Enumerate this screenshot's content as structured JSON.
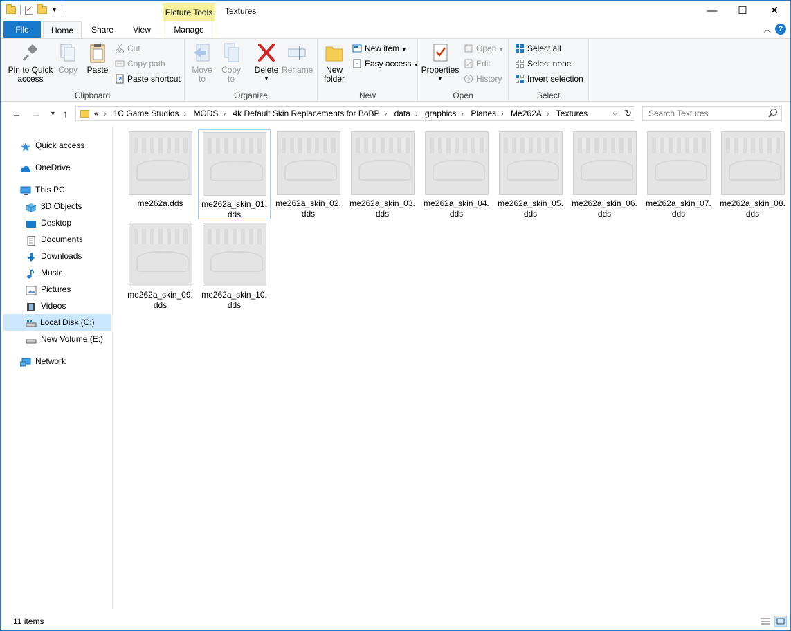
{
  "window": {
    "title": "Textures",
    "context_tab": "Picture Tools",
    "controls": {
      "minimize": "—",
      "maximize": "☐",
      "close": "✕"
    }
  },
  "tabs": [
    {
      "label": "File"
    },
    {
      "label": "Home"
    },
    {
      "label": "Share"
    },
    {
      "label": "View"
    },
    {
      "label": "Manage"
    }
  ],
  "ribbon": {
    "clipboard": {
      "label": "Clipboard",
      "pin": "Pin to Quick access",
      "pin_l1": "Pin to Quick",
      "pin_l2": "access",
      "copy": "Copy",
      "paste": "Paste",
      "cut": "Cut",
      "copy_path": "Copy path",
      "paste_shortcut": "Paste shortcut"
    },
    "organize": {
      "label": "Organize",
      "move_l1": "Move",
      "move_l2": "to",
      "copy_l1": "Copy",
      "copy_l2": "to",
      "delete": "Delete",
      "rename": "Rename"
    },
    "new": {
      "label": "New",
      "folder_l1": "New",
      "folder_l2": "folder",
      "new_item": "New item",
      "easy_access": "Easy access"
    },
    "open": {
      "label": "Open",
      "properties": "Properties",
      "open": "Open",
      "edit": "Edit",
      "history": "History"
    },
    "select": {
      "label": "Select",
      "select_all": "Select all",
      "select_none": "Select none",
      "invert": "Invert selection"
    }
  },
  "address": {
    "overflow": "«",
    "crumbs": [
      "1C Game Studios",
      "MODS",
      "4k Default Skin Replacements for BoBP",
      "data",
      "graphics",
      "Planes",
      "Me262A",
      "Textures"
    ]
  },
  "search": {
    "placeholder": "Search Textures"
  },
  "sidebar": {
    "items": [
      {
        "label": "Quick access",
        "icon": "star-icon"
      },
      {
        "label": "OneDrive",
        "icon": "cloud-icon"
      },
      {
        "label": "This PC",
        "icon": "monitor-icon"
      },
      {
        "label": "3D Objects",
        "icon": "cube-icon"
      },
      {
        "label": "Desktop",
        "icon": "desktop-icon"
      },
      {
        "label": "Documents",
        "icon": "document-icon"
      },
      {
        "label": "Downloads",
        "icon": "download-arrow-icon"
      },
      {
        "label": "Music",
        "icon": "music-note-icon"
      },
      {
        "label": "Pictures",
        "icon": "picture-icon"
      },
      {
        "label": "Videos",
        "icon": "film-icon"
      },
      {
        "label": "Local Disk (C:)",
        "icon": "drive-icon"
      },
      {
        "label": "New Volume (E:)",
        "icon": "drive-icon"
      },
      {
        "label": "Network",
        "icon": "network-icon"
      }
    ]
  },
  "files": [
    {
      "l1": "me262a.dds",
      "l2": ""
    },
    {
      "l1": "me262a_skin_01.",
      "l2": "dds"
    },
    {
      "l1": "me262a_skin_02.",
      "l2": "dds"
    },
    {
      "l1": "me262a_skin_03.",
      "l2": "dds"
    },
    {
      "l1": "me262a_skin_04.",
      "l2": "dds"
    },
    {
      "l1": "me262a_skin_05.",
      "l2": "dds"
    },
    {
      "l1": "me262a_skin_06.",
      "l2": "dds"
    },
    {
      "l1": "me262a_skin_07.",
      "l2": "dds"
    },
    {
      "l1": "me262a_skin_08.",
      "l2": "dds"
    },
    {
      "l1": "me262a_skin_09.",
      "l2": "dds"
    },
    {
      "l1": "me262a_skin_10.",
      "l2": "dds"
    }
  ],
  "status": {
    "count": "11 items"
  },
  "colors": {
    "accent": "#1979ca",
    "selection": "#cce8ff",
    "context_tab": "#f7f19c",
    "delete_red": "#d32020"
  }
}
